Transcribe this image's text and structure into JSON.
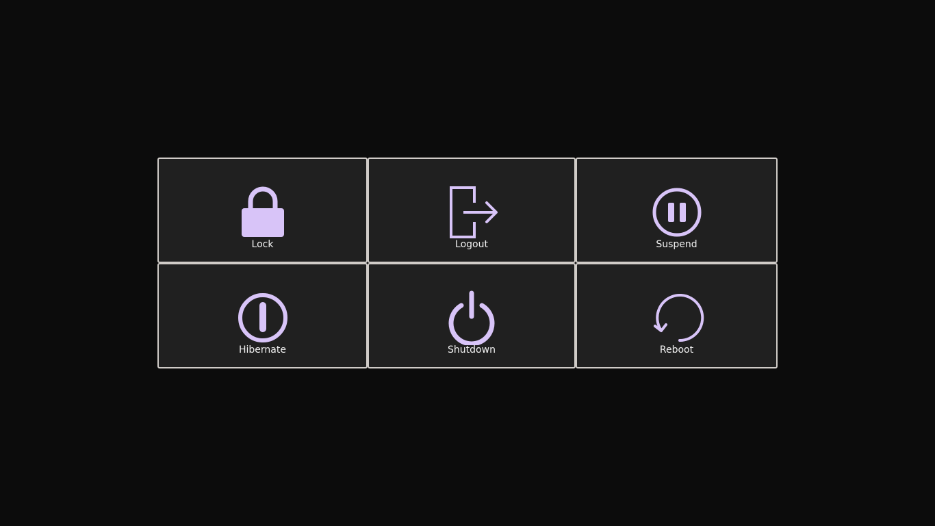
{
  "theme": {
    "background": "#0c0c0c",
    "tile_background": "#202020",
    "tile_border": "#d0ccc8",
    "icon_color": "#d8c4f8",
    "label_color": "#f2f2f2"
  },
  "power_menu": {
    "options": [
      {
        "label": "Lock",
        "icon": "lock-icon"
      },
      {
        "label": "Logout",
        "icon": "logout-icon"
      },
      {
        "label": "Suspend",
        "icon": "pause-circle-icon"
      },
      {
        "label": "Hibernate",
        "icon": "hibernate-icon"
      },
      {
        "label": "Shutdown",
        "icon": "power-icon"
      },
      {
        "label": "Reboot",
        "icon": "reboot-icon"
      }
    ]
  }
}
